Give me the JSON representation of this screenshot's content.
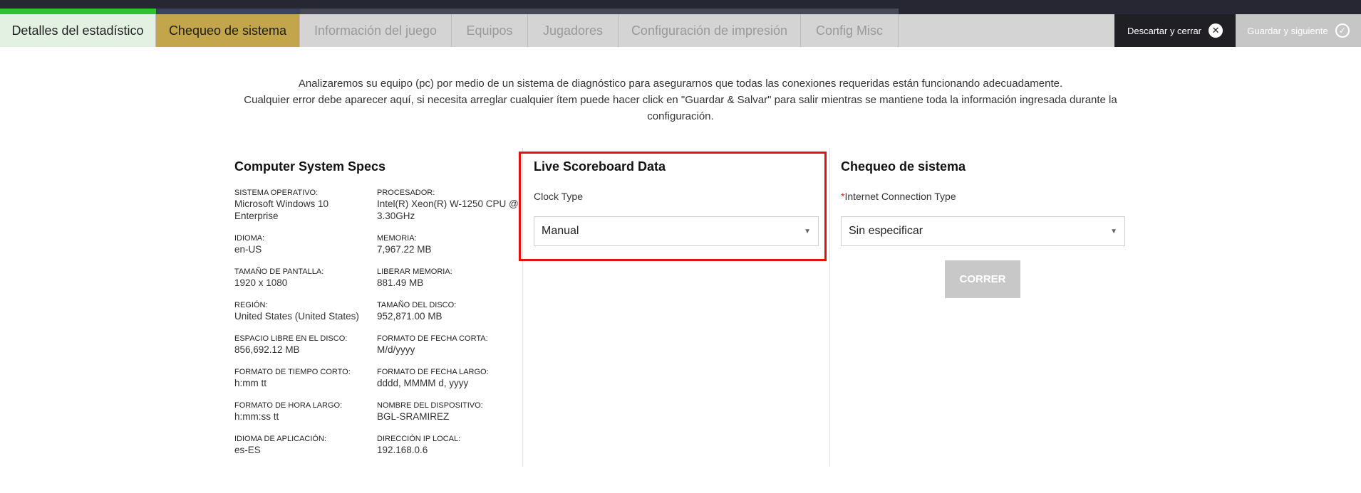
{
  "tabs": [
    {
      "label": "Detalles del estadístico",
      "state": "done"
    },
    {
      "label": "Chequeo de sistema",
      "state": "active"
    },
    {
      "label": "Información del juego",
      "state": "inactive"
    },
    {
      "label": "Equipos",
      "state": "inactive"
    },
    {
      "label": "Jugadores",
      "state": "inactive"
    },
    {
      "label": "Configuración de impresión",
      "state": "inactive"
    },
    {
      "label": "Config Misc",
      "state": "inactive"
    }
  ],
  "actions": {
    "discard_label": "Descartar y cerrar",
    "discard_icon": "close-icon",
    "save_label": "Guardar y siguiente",
    "save_icon": "check-icon"
  },
  "intro": {
    "line1": "Analizaremos su equipo (pc) por medio de un sistema de diagnóstico para asegurarnos que todas las conexiones requeridas están funcionando adecuadamente.",
    "line2": "Cualquier error debe aparecer aquí, si necesita arreglar cualquier ítem puede hacer click en \"Guardar & Salvar\" para salir mientras se mantiene toda la información ingresada durante la configuración."
  },
  "specs": {
    "title": "Computer System Specs",
    "items": [
      {
        "label": "SISTEMA OPERATIVO:",
        "value": "Microsoft Windows 10 Enterprise"
      },
      {
        "label": "PROCESADOR:",
        "value": "Intel(R) Xeon(R) W-1250 CPU @ 3.30GHz"
      },
      {
        "label": "IDIOMA:",
        "value": "en-US"
      },
      {
        "label": "MEMORIA:",
        "value": "7,967.22 MB"
      },
      {
        "label": "TAMAÑO DE PANTALLA:",
        "value": "1920 x 1080"
      },
      {
        "label": "LIBERAR MEMORIA:",
        "value": "881.49 MB"
      },
      {
        "label": "REGIÓN:",
        "value": "United States (United States)"
      },
      {
        "label": "TAMAÑO DEL DISCO:",
        "value": "952,871.00 MB"
      },
      {
        "label": "ESPACIO LIBRE EN EL DISCO:",
        "value": "856,692.12 MB"
      },
      {
        "label": "FORMATO DE FECHA CORTA:",
        "value": "M/d/yyyy"
      },
      {
        "label": "FORMATO DE TIEMPO CORTO:",
        "value": "h:mm tt"
      },
      {
        "label": "FORMATO DE FECHA LARGO:",
        "value": "dddd, MMMM d, yyyy"
      },
      {
        "label": "FORMATO DE HORA LARGO:",
        "value": "h:mm:ss tt"
      },
      {
        "label": "NOMBRE DEL DISPOSITIVO:",
        "value": "BGL-SRAMIREZ"
      },
      {
        "label": "IDIOMA DE APLICACIÓN:",
        "value": "es-ES"
      },
      {
        "label": "DIRECCIÓN IP LOCAL:",
        "value": "192.168.0.6"
      }
    ]
  },
  "scoreboard": {
    "title": "Live Scoreboard Data",
    "clock_label": "Clock Type",
    "clock_value": "Manual"
  },
  "check": {
    "title": "Chequeo de sistema",
    "required_mark": "*",
    "connection_label": "Internet Connection Type",
    "connection_value": "Sin especificar",
    "run_label": "CORRER"
  },
  "colors": {
    "accent_active_tab": "#c3a64c",
    "done_tab": "#e2f1e2",
    "highlight_border": "#e31212",
    "progress_green": "#2ec231"
  }
}
